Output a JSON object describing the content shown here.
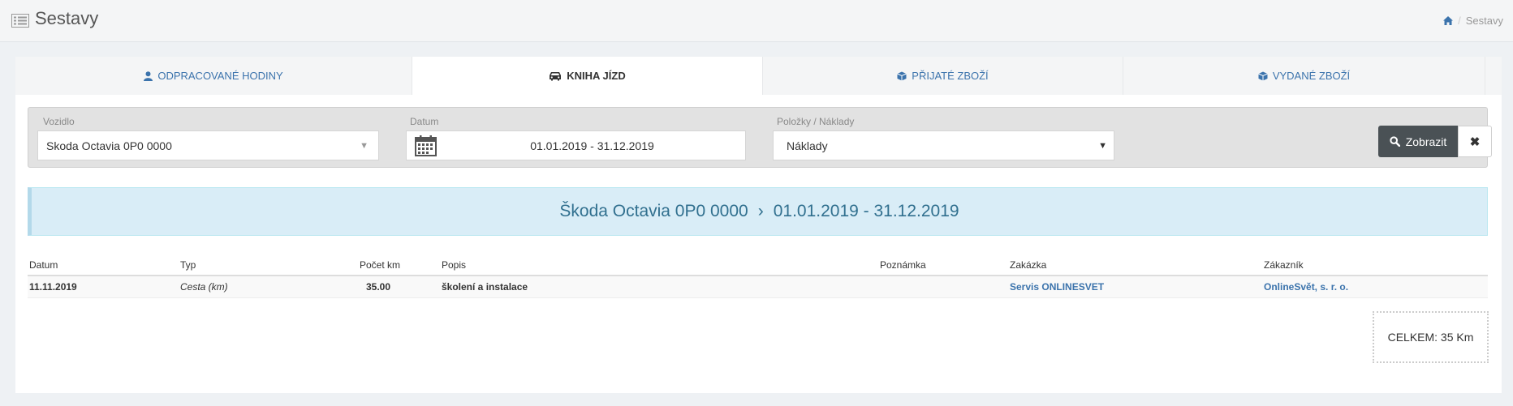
{
  "header": {
    "title": "Sestavy"
  },
  "breadcrumb": {
    "current": "Sestavy"
  },
  "tabs": [
    {
      "label": "ODPRACOVANÉ HODINY",
      "icon": "user-icon"
    },
    {
      "label": "KNIHA JÍZD",
      "icon": "car-icon",
      "active": true
    },
    {
      "label": "PŘIJATÉ ZBOŽÍ",
      "icon": "cube-icon"
    },
    {
      "label": "VYDANÉ ZBOŽÍ",
      "icon": "cube-icon"
    }
  ],
  "filters": {
    "vehicle": {
      "label": "Vozidlo",
      "value": "Skoda Octavia 0P0 0000"
    },
    "date": {
      "label": "Datum",
      "value": "01.01.2019 - 31.12.2019"
    },
    "items": {
      "label": "Položky / Náklady",
      "value": "Náklady"
    },
    "show_label": "Zobrazit",
    "clear_label": "✖"
  },
  "banner": {
    "vehicle": "Škoda Octavia 0P0 0000",
    "sep": "›",
    "range": "01.01.2019 - 31.12.2019"
  },
  "table": {
    "headers": [
      "Datum",
      "Typ",
      "Počet km",
      "Popis",
      "Poznámka",
      "Zakázka",
      "Zákazník"
    ],
    "rows": [
      [
        "11.11.2019",
        "Cesta (km)",
        "35.00",
        "školení a instalace",
        "",
        "Servis ONLINESVET",
        "OnlineSvět, s. r. o."
      ]
    ]
  },
  "total": "CELKEM: 35 Km",
  "colors": {
    "accent": "#3b73ac",
    "banner_bg": "#d9edf7",
    "banner_text": "#31708f",
    "button_dark": "#4a5155"
  }
}
